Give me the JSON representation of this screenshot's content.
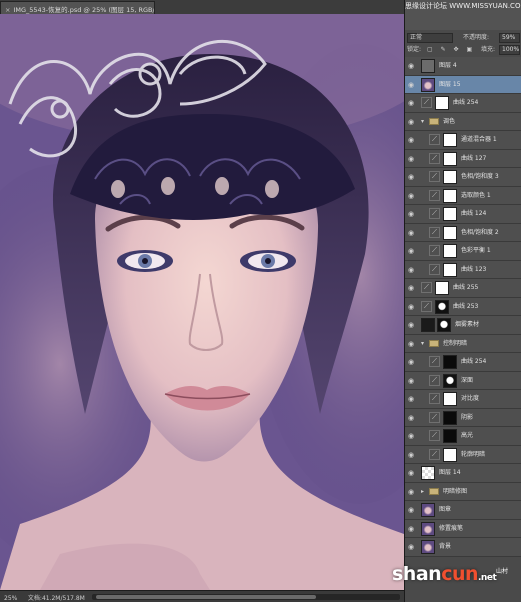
{
  "document": {
    "close_glyph": "×",
    "tab_title": "IMG_5543-恢复的.psd @ 25% (图层 15, RGB/8) *",
    "zoom": "25%",
    "doc_size": "文档:41.2M/517.8M"
  },
  "panel": {
    "site_watermark": "思缘设计论坛 WWW.MISSYUAN.COM",
    "blend_mode": "正常",
    "opacity_label": "不透明度:",
    "opacity_value": "59%",
    "lock_label": "锁定:",
    "fill_label": "填充:",
    "fill_value": "100%",
    "layers": [
      {
        "name": "图层 4",
        "kind": "pixel",
        "indent": 0
      },
      {
        "name": "图层 15",
        "kind": "pixel-portrait",
        "indent": 0,
        "selected": true
      },
      {
        "name": "曲线 254",
        "kind": "adj",
        "indent": 0,
        "mask": "white"
      },
      {
        "name": "调色",
        "kind": "group",
        "indent": 0,
        "expanded": true
      },
      {
        "name": "通道混合器 1",
        "kind": "adj",
        "indent": 1,
        "mask": "white"
      },
      {
        "name": "曲线 127",
        "kind": "adj",
        "indent": 1,
        "mask": "white"
      },
      {
        "name": "色相/饱和度 3",
        "kind": "adj",
        "indent": 1,
        "mask": "white"
      },
      {
        "name": "选取颜色 1",
        "kind": "adj",
        "indent": 1,
        "mask": "white"
      },
      {
        "name": "曲线 124",
        "kind": "adj",
        "indent": 1,
        "mask": "white"
      },
      {
        "name": "色相/饱和度 2",
        "kind": "adj",
        "indent": 1,
        "mask": "white"
      },
      {
        "name": "色彩平衡 1",
        "kind": "adj",
        "indent": 1,
        "mask": "white"
      },
      {
        "name": "曲线 123",
        "kind": "adj",
        "indent": 1,
        "mask": "white"
      },
      {
        "name": "曲线 255",
        "kind": "adj",
        "indent": 0,
        "mask": "white"
      },
      {
        "name": "曲线 253",
        "kind": "adj",
        "indent": 0,
        "mask": "face"
      },
      {
        "name": "烟雾素材",
        "kind": "pixel-smoke",
        "indent": 0,
        "mask": "face"
      },
      {
        "name": "控制明暗",
        "kind": "group",
        "indent": 0,
        "expanded": true
      },
      {
        "name": "曲线 254",
        "kind": "adj",
        "indent": 1,
        "mask": "black"
      },
      {
        "name": "深面",
        "kind": "adj",
        "indent": 1,
        "mask": "face"
      },
      {
        "name": "对比度",
        "kind": "adj",
        "indent": 1,
        "mask": "white"
      },
      {
        "name": "阴影",
        "kind": "adj",
        "indent": 1,
        "mask": "black"
      },
      {
        "name": "高光",
        "kind": "adj",
        "indent": 1,
        "mask": "black"
      },
      {
        "name": "轮廓明暗",
        "kind": "adj",
        "indent": 1,
        "mask": "white"
      },
      {
        "name": "图层 14",
        "kind": "pixel-checker",
        "indent": 0
      },
      {
        "name": "明暗修图",
        "kind": "group",
        "indent": 0,
        "expanded": false
      },
      {
        "name": "图章",
        "kind": "pixel-portrait",
        "indent": 0
      },
      {
        "name": "修置痕笔",
        "kind": "pixel-portrait",
        "indent": 0
      },
      {
        "name": "背景",
        "kind": "pixel-portrait",
        "indent": 0
      }
    ]
  },
  "watermark": {
    "brand_white": "shan",
    "brand_red": "cun",
    "brand_tld": ".net",
    "sub": "山村"
  },
  "icons": {
    "visibility": "eye-icon",
    "folder": "folder-icon",
    "adjustment": "adjustment-layer-icon"
  },
  "colors": {
    "selection": "#6886a8",
    "panel_bg": "#4a4a4a",
    "brand_red": "#f04f2f"
  }
}
